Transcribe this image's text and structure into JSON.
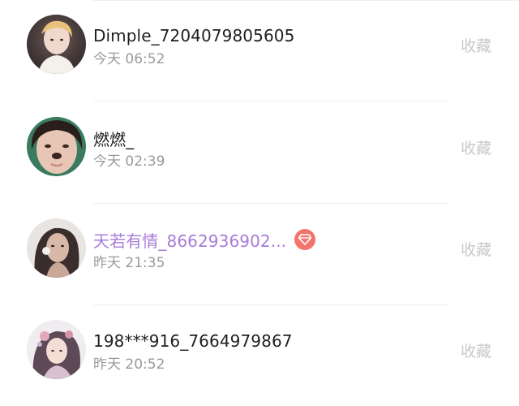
{
  "followers": [
    {
      "name": "Dimple_7204079805605",
      "time": "今天 06:52",
      "action": "收藏",
      "vip": false,
      "avatar": "avatar-1"
    },
    {
      "name": "燃燃_",
      "time": "今天 02:39",
      "action": "收藏",
      "vip": false,
      "avatar": "avatar-2"
    },
    {
      "name": "天若有情_8662936902...",
      "time": "昨天 21:35",
      "action": "收藏",
      "vip": true,
      "badge_icon": "diamond-icon",
      "avatar": "avatar-3"
    },
    {
      "name": "198***916_7664979867",
      "time": "昨天 20:52",
      "action": "收藏",
      "vip": false,
      "avatar": "avatar-4"
    }
  ],
  "colors": {
    "name": "#1f1f1f",
    "vip_name": "#a77cd8",
    "time": "#9a9a9a",
    "action": "#c8c8c8",
    "vip_badge": "#f2746d"
  }
}
